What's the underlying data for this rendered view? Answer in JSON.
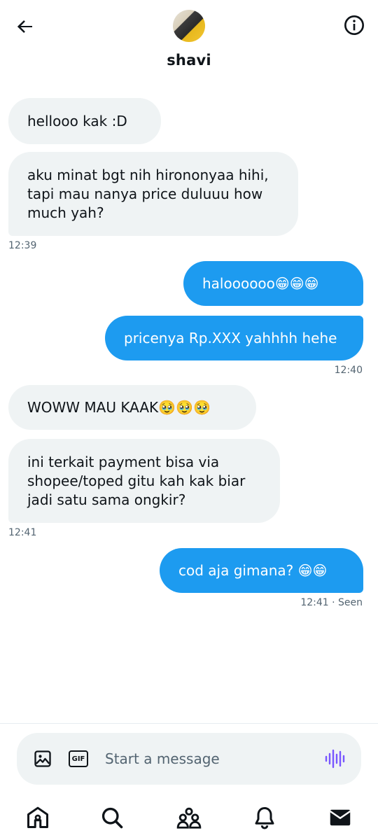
{
  "header": {
    "name": "shavi",
    "back_icon": "arrow-left-icon",
    "info_icon": "info-icon"
  },
  "messages": [
    {
      "id": "m1",
      "direction": "in",
      "text": "hellooo kak :D"
    },
    {
      "id": "m2",
      "direction": "in",
      "lines": [
        "aku minat bgt nih hirononyaa hihi,",
        "tapi mau nanya price duluuu how",
        "much yah?"
      ],
      "time": "12:39"
    },
    {
      "id": "m3",
      "direction": "out",
      "text": "haloooooo😁😁😁"
    },
    {
      "id": "m4",
      "direction": "out",
      "text": "pricenya Rp.XXX yahhhh hehe",
      "time": "12:40"
    },
    {
      "id": "m5",
      "direction": "in",
      "text": "WOWW MAU KAAK🥹🥹🥹"
    },
    {
      "id": "m6",
      "direction": "in",
      "lines": [
        "ini terkait payment bisa via",
        "shopee/toped gitu kah kak biar",
        "jadi satu sama ongkir?"
      ],
      "time": "12:41"
    },
    {
      "id": "m7",
      "direction": "out",
      "text": "cod aja gimana? 😁😁",
      "time": "12:41 · Seen"
    }
  ],
  "composer": {
    "placeholder": "Start a message",
    "gif_label": "GIF",
    "colors": {
      "voice": "#7856ff",
      "outgoing_bubble": "#1d9bf0",
      "incoming_bubble": "#eff3f4"
    }
  },
  "tabbar": {
    "items": [
      "home-icon",
      "search-icon",
      "communities-icon",
      "notifications-icon",
      "messages-icon"
    ],
    "active": "messages-icon"
  }
}
